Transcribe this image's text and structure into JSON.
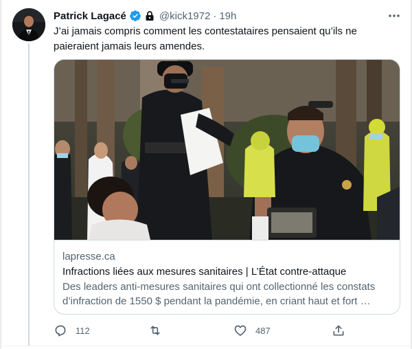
{
  "tweet": {
    "author_name": "Patrick Lagacé",
    "handle": "@kick1972",
    "separator": "·",
    "time": "19h",
    "verified": true,
    "protected": true,
    "text": "J’ai jamais compris comment les contestataires pensaient qu’ils ne paieraient jamais leurs amendes."
  },
  "card": {
    "domain": "lapresse.ca",
    "title": "Infractions liées aux mesures sanitaires | L’État contre-attaque",
    "description": "Des leaders anti-mesures sanitaires qui ont collectionné les constats d’infraction de 1550 $ pendant la pandémie, en criant haut et fort …"
  },
  "actions": {
    "reply_count": "112",
    "retweet_count": "",
    "like_count": "487"
  },
  "icons": {
    "more": "more-dots-icon",
    "verified": "verified-badge-icon",
    "lock": "lock-icon",
    "reply": "reply-icon",
    "retweet": "retweet-icon",
    "like": "heart-icon",
    "share": "share-icon"
  },
  "colors": {
    "text": "#0f1419",
    "secondary_text": "#536471",
    "verified_blue": "#1d9bf0",
    "border": "#cfd9de"
  }
}
